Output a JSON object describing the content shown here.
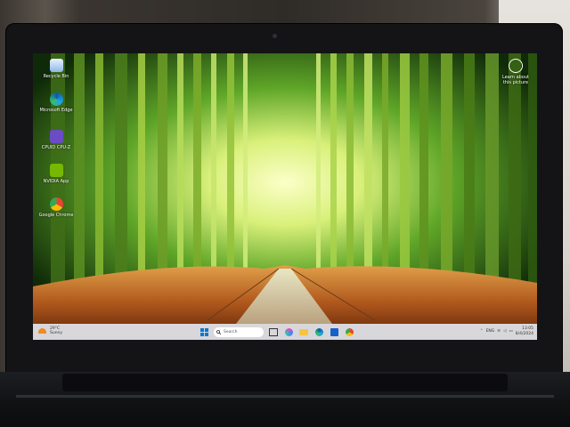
{
  "desktop": {
    "icons": [
      {
        "label": "Recycle Bin",
        "icon": "recycle-bin-icon"
      },
      {
        "label": "Microsoft Edge",
        "icon": "edge-icon"
      },
      {
        "label": "CPUID CPU-Z",
        "icon": "cpuz-icon"
      },
      {
        "label": "NVIDIA App",
        "icon": "nvidia-icon"
      },
      {
        "label": "Google Chrome",
        "icon": "chrome-icon"
      }
    ],
    "spotlight": {
      "label": "Learn about this picture",
      "icon": "spotlight-icon"
    }
  },
  "taskbar": {
    "weather": {
      "temp": "29°C",
      "condition": "Sunny",
      "icon": "sun-icon"
    },
    "search_placeholder": "Search",
    "pinned": [
      "start-icon",
      "search-icon",
      "task-view-icon",
      "copilot-icon",
      "file-explorer-icon",
      "edge-icon",
      "store-icon",
      "chrome-icon"
    ],
    "tray": {
      "lang": "ENG",
      "time": "13:05",
      "date": "8/4/2024"
    }
  },
  "colors": {
    "taskbar": "#e1e4eb",
    "accent": "#0078d4",
    "sun": "#f08a26"
  }
}
